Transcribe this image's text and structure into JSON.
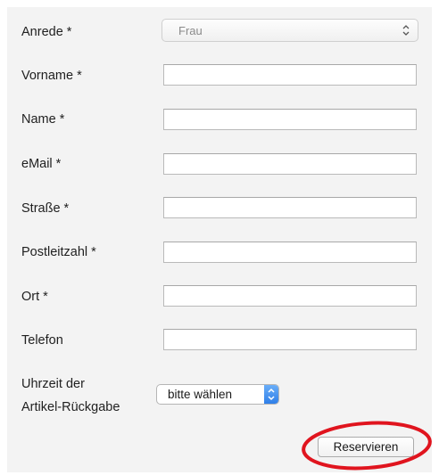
{
  "form": {
    "fields": [
      {
        "key": "vorname",
        "label": "Vorname *",
        "value": ""
      },
      {
        "key": "name",
        "label": "Name *",
        "value": ""
      },
      {
        "key": "email",
        "label": "eMail *",
        "value": ""
      },
      {
        "key": "strasse",
        "label": "Straße *",
        "value": ""
      },
      {
        "key": "plz",
        "label": "Postleitzahl *",
        "value": ""
      },
      {
        "key": "ort",
        "label": "Ort *",
        "value": ""
      },
      {
        "key": "telefon",
        "label": "Telefon",
        "value": ""
      }
    ],
    "anrede": {
      "label": "Anrede *",
      "selected": "Frau",
      "icon": "chevron-up-down-icon"
    },
    "uhrzeit": {
      "label_line1": "Uhrzeit der",
      "label_line2": "Artikel-Rückgabe",
      "selected": "bitte wählen",
      "icon": "chevron-up-down-icon"
    },
    "submit_label": "Reservieren"
  },
  "colors": {
    "panel_background": "#f3f3f3",
    "select_accent": "#2f7fe8",
    "highlight_annotation": "#e0141e"
  }
}
